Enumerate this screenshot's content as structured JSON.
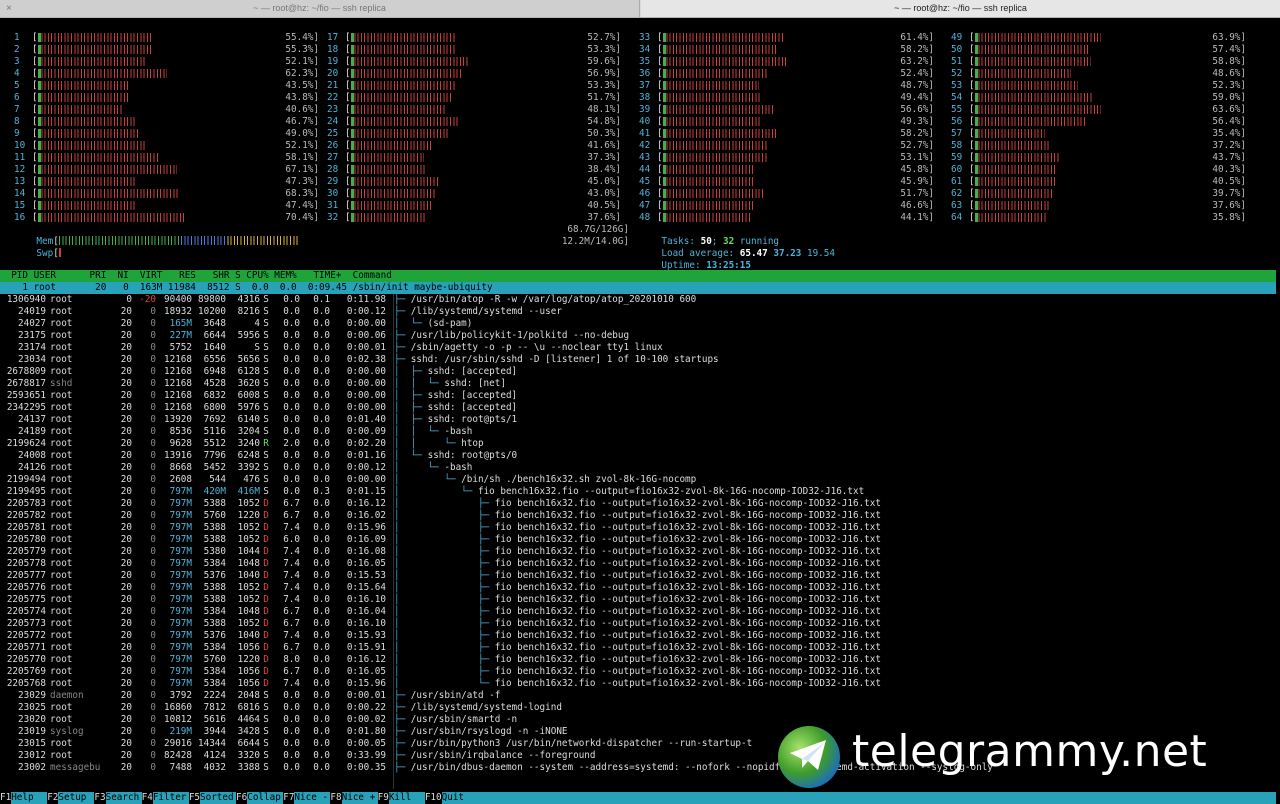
{
  "tabs": [
    "~ — root@hz: ~/fio — ssh replica",
    "~ — root@hz: ~/fio — ssh replica"
  ],
  "close_glyph": "×",
  "cpus": [
    {
      "id": "1",
      "pct": "55.4%]",
      "v": 55.4
    },
    {
      "id": "2",
      "pct": "55.3%]",
      "v": 55.3
    },
    {
      "id": "3",
      "pct": "52.1%]",
      "v": 52.1
    },
    {
      "id": "4",
      "pct": "62.3%]",
      "v": 62.3
    },
    {
      "id": "5",
      "pct": "43.5%]",
      "v": 43.5
    },
    {
      "id": "6",
      "pct": "43.8%]",
      "v": 43.8
    },
    {
      "id": "7",
      "pct": "40.6%]",
      "v": 40.6
    },
    {
      "id": "8",
      "pct": "46.7%]",
      "v": 46.7
    },
    {
      "id": "9",
      "pct": "49.0%]",
      "v": 49.0
    },
    {
      "id": "10",
      "pct": "52.1%]",
      "v": 52.1
    },
    {
      "id": "11",
      "pct": "58.1%]",
      "v": 58.1
    },
    {
      "id": "12",
      "pct": "67.1%]",
      "v": 67.1
    },
    {
      "id": "13",
      "pct": "47.3%]",
      "v": 47.3
    },
    {
      "id": "14",
      "pct": "68.3%]",
      "v": 68.3
    },
    {
      "id": "15",
      "pct": "47.4%]",
      "v": 47.4
    },
    {
      "id": "16",
      "pct": "70.4%]",
      "v": 70.4
    },
    {
      "id": "17",
      "pct": "52.7%]",
      "v": 52.7
    },
    {
      "id": "18",
      "pct": "53.3%]",
      "v": 53.3
    },
    {
      "id": "19",
      "pct": "59.6%]",
      "v": 59.6
    },
    {
      "id": "20",
      "pct": "56.9%]",
      "v": 56.9
    },
    {
      "id": "21",
      "pct": "53.3%]",
      "v": 53.3
    },
    {
      "id": "22",
      "pct": "51.7%]",
      "v": 51.7
    },
    {
      "id": "23",
      "pct": "48.1%]",
      "v": 48.1
    },
    {
      "id": "24",
      "pct": "54.8%]",
      "v": 54.8
    },
    {
      "id": "25",
      "pct": "50.3%]",
      "v": 50.3
    },
    {
      "id": "26",
      "pct": "41.6%]",
      "v": 41.6
    },
    {
      "id": "27",
      "pct": "37.3%]",
      "v": 37.3
    },
    {
      "id": "28",
      "pct": "38.4%]",
      "v": 38.4
    },
    {
      "id": "29",
      "pct": "45.0%]",
      "v": 45.0
    },
    {
      "id": "30",
      "pct": "43.0%]",
      "v": 43.0
    },
    {
      "id": "31",
      "pct": "40.5%]",
      "v": 40.5
    },
    {
      "id": "32",
      "pct": "37.6%]",
      "v": 37.6
    },
    {
      "id": "33",
      "pct": "61.4%]",
      "v": 61.4
    },
    {
      "id": "34",
      "pct": "58.2%]",
      "v": 58.2
    },
    {
      "id": "35",
      "pct": "63.2%]",
      "v": 63.2
    },
    {
      "id": "36",
      "pct": "52.4%]",
      "v": 52.4
    },
    {
      "id": "37",
      "pct": "48.7%]",
      "v": 48.7
    },
    {
      "id": "38",
      "pct": "49.4%]",
      "v": 49.4
    },
    {
      "id": "39",
      "pct": "56.6%]",
      "v": 56.6
    },
    {
      "id": "40",
      "pct": "49.3%]",
      "v": 49.3
    },
    {
      "id": "41",
      "pct": "58.2%]",
      "v": 58.2
    },
    {
      "id": "42",
      "pct": "52.7%]",
      "v": 52.7
    },
    {
      "id": "43",
      "pct": "53.1%]",
      "v": 53.1
    },
    {
      "id": "44",
      "pct": "45.8%]",
      "v": 45.8
    },
    {
      "id": "45",
      "pct": "45.9%]",
      "v": 45.9
    },
    {
      "id": "46",
      "pct": "51.7%]",
      "v": 51.7
    },
    {
      "id": "47",
      "pct": "46.6%]",
      "v": 46.6
    },
    {
      "id": "48",
      "pct": "44.1%]",
      "v": 44.1
    },
    {
      "id": "49",
      "pct": "63.9%]",
      "v": 63.9
    },
    {
      "id": "50",
      "pct": "57.4%]",
      "v": 57.4
    },
    {
      "id": "51",
      "pct": "58.8%]",
      "v": 58.8
    },
    {
      "id": "52",
      "pct": "48.6%]",
      "v": 48.6
    },
    {
      "id": "53",
      "pct": "52.3%]",
      "v": 52.3
    },
    {
      "id": "54",
      "pct": "59.0%]",
      "v": 59.0
    },
    {
      "id": "55",
      "pct": "63.6%]",
      "v": 63.6
    },
    {
      "id": "56",
      "pct": "56.4%]",
      "v": 56.4
    },
    {
      "id": "57",
      "pct": "35.4%]",
      "v": 35.4
    },
    {
      "id": "58",
      "pct": "37.2%]",
      "v": 37.2
    },
    {
      "id": "59",
      "pct": "43.7%]",
      "v": 43.7
    },
    {
      "id": "60",
      "pct": "40.3%]",
      "v": 40.3
    },
    {
      "id": "61",
      "pct": "40.5%]",
      "v": 40.5
    },
    {
      "id": "62",
      "pct": "39.7%]",
      "v": 39.7
    },
    {
      "id": "63",
      "pct": "37.6%]",
      "v": 37.6
    },
    {
      "id": "64",
      "pct": "35.8%]",
      "v": 35.8
    }
  ],
  "mem": {
    "label": "Mem",
    "value": "68.7G/126G]",
    "fill": 0.55
  },
  "swp": {
    "label": "Swp",
    "value": "12.2M/14.0G]",
    "fill": 0.001
  },
  "tasks": {
    "label": "Tasks:",
    "count": "50",
    "sep": ";",
    "running": "32",
    "running_label": "running"
  },
  "load": {
    "label": "Load average:",
    "l1": "65.47",
    "l5": "37.23",
    "l15": "19.54"
  },
  "uptime": {
    "label": "Uptime:",
    "value": "13:25:15"
  },
  "header": "  PID USER      PRI  NI  VIRT   RES   SHR S CPU% MEM%   TIME+  Command",
  "selected": "    1 root       20   0  163M 11984  8512 S  0.0  0.0  0:09.45 /sbin/init maybe-ubiquity",
  "rows": [
    {
      "pid": "1306940",
      "user": "root",
      "pri": "0",
      "ni": "-20",
      "virt": "90400",
      "res": "89800",
      "shr": "4316",
      "s": "S",
      "cpu": "0.0",
      "mem": "0.1",
      "time": "0:11.98",
      "tree": "├─ ",
      "cmd": "/usr/bin/atop -R -w /var/log/atop/atop_20201010 600"
    },
    {
      "pid": "24019",
      "user": "root",
      "pri": "20",
      "ni": "0",
      "virt": "18932",
      "res": "10200",
      "shr": "8216",
      "s": "S",
      "cpu": "0.0",
      "mem": "0.0",
      "time": "0:00.12",
      "tree": "├─ ",
      "cmd": "/lib/systemd/systemd --user"
    },
    {
      "pid": "24027",
      "user": "root",
      "pri": "20",
      "ni": "0",
      "virt": "165M",
      "res": "3648",
      "shr": "4",
      "s": "S",
      "cpu": "0.0",
      "mem": "0.0",
      "time": "0:00.00",
      "tree": "│  └─ ",
      "cmd": "(sd-pam)"
    },
    {
      "pid": "23175",
      "user": "root",
      "pri": "20",
      "ni": "0",
      "virt": "227M",
      "res": "6644",
      "shr": "5956",
      "s": "S",
      "cpu": "0.0",
      "mem": "0.0",
      "time": "0:00.06",
      "tree": "├─ ",
      "cmd": "/usr/lib/policykit-1/polkitd --no-debug"
    },
    {
      "pid": "23174",
      "user": "root",
      "pri": "20",
      "ni": "0",
      "virt": "5752",
      "res": "1640",
      "shr": "S",
      "s": "S",
      "cpu": "0.0",
      "mem": "0.0",
      "time": "0:00.01",
      "tree": "├─ ",
      "cmd": "/sbin/agetty -o -p -- \\u --noclear tty1 linux"
    },
    {
      "pid": "23034",
      "user": "root",
      "pri": "20",
      "ni": "0",
      "virt": "12168",
      "res": "6556",
      "shr": "5656",
      "s": "S",
      "cpu": "0.0",
      "mem": "0.0",
      "time": "0:02.38",
      "tree": "├─ ",
      "cmd": "sshd: /usr/sbin/sshd -D [listener] 1 of 10-100 startups"
    },
    {
      "pid": "2678809",
      "user": "root",
      "pri": "20",
      "ni": "0",
      "virt": "12168",
      "res": "6948",
      "shr": "6128",
      "s": "S",
      "cpu": "0.0",
      "mem": "0.0",
      "time": "0:00.00",
      "tree": "│  ├─ ",
      "cmd": "sshd: [accepted]"
    },
    {
      "pid": "2678817",
      "user": "sshd",
      "pri": "20",
      "ni": "0",
      "virt": "12168",
      "res": "4528",
      "shr": "3620",
      "s": "S",
      "cpu": "0.0",
      "mem": "0.0",
      "time": "0:00.00",
      "tree": "│  │  └─ ",
      "cmd": "sshd: [net]"
    },
    {
      "pid": "2593651",
      "user": "root",
      "pri": "20",
      "ni": "0",
      "virt": "12168",
      "res": "6832",
      "shr": "6008",
      "s": "S",
      "cpu": "0.0",
      "mem": "0.0",
      "time": "0:00.00",
      "tree": "│  ├─ ",
      "cmd": "sshd: [accepted]"
    },
    {
      "pid": "2342295",
      "user": "root",
      "pri": "20",
      "ni": "0",
      "virt": "12168",
      "res": "6800",
      "shr": "5976",
      "s": "S",
      "cpu": "0.0",
      "mem": "0.0",
      "time": "0:00.00",
      "tree": "│  ├─ ",
      "cmd": "sshd: [accepted]"
    },
    {
      "pid": "24137",
      "user": "root",
      "pri": "20",
      "ni": "0",
      "virt": "13920",
      "res": "7692",
      "shr": "6140",
      "s": "S",
      "cpu": "0.0",
      "mem": "0.0",
      "time": "0:01.40",
      "tree": "│  ├─ ",
      "cmd": "sshd: root@pts/1"
    },
    {
      "pid": "24189",
      "user": "root",
      "pri": "20",
      "ni": "0",
      "virt": "8536",
      "res": "5116",
      "shr": "3204",
      "s": "S",
      "cpu": "0.0",
      "mem": "0.0",
      "time": "0:00.09",
      "tree": "│  │  └─ ",
      "cmd": "-bash"
    },
    {
      "pid": "2199624",
      "user": "root",
      "pri": "20",
      "ni": "0",
      "virt": "9628",
      "res": "5512",
      "shr": "3240",
      "s": "R",
      "cpu": "2.0",
      "mem": "0.0",
      "time": "0:02.20",
      "tree": "│  │     └─ ",
      "cmd": "htop"
    },
    {
      "pid": "24008",
      "user": "root",
      "pri": "20",
      "ni": "0",
      "virt": "13916",
      "res": "7796",
      "shr": "6248",
      "s": "S",
      "cpu": "0.0",
      "mem": "0.0",
      "time": "0:01.16",
      "tree": "│  └─ ",
      "cmd": "sshd: root@pts/0"
    },
    {
      "pid": "24126",
      "user": "root",
      "pri": "20",
      "ni": "0",
      "virt": "8668",
      "res": "5452",
      "shr": "3392",
      "s": "S",
      "cpu": "0.0",
      "mem": "0.0",
      "time": "0:00.12",
      "tree": "│     └─ ",
      "cmd": "-bash"
    },
    {
      "pid": "2199494",
      "user": "root",
      "pri": "20",
      "ni": "0",
      "virt": "2608",
      "res": "544",
      "shr": "476",
      "s": "S",
      "cpu": "0.0",
      "mem": "0.0",
      "time": "0:00.00",
      "tree": "│        └─ ",
      "cmd": "/bin/sh ./bench16x32.sh zvol-8k-16G-nocomp"
    },
    {
      "pid": "2199495",
      "user": "root",
      "pri": "20",
      "ni": "0",
      "virt": "797M",
      "res": "420M",
      "shr": "416M",
      "s": "S",
      "cpu": "0.0",
      "mem": "0.3",
      "time": "0:01.15",
      "tree": "│           └─ ",
      "cmd": "fio bench16x32.fio --output=fio16x32-zvol-8k-16G-nocomp-IOD32-J16.txt"
    },
    {
      "pid": "2205783",
      "user": "root",
      "pri": "20",
      "ni": "0",
      "virt": "797M",
      "res": "5388",
      "shr": "1052",
      "s": "D",
      "cpu": "6.7",
      "mem": "0.0",
      "time": "0:16.12",
      "tree": "│              ├─ ",
      "cmd": "fio bench16x32.fio --output=fio16x32-zvol-8k-16G-nocomp-IOD32-J16.txt"
    },
    {
      "pid": "2205782",
      "user": "root",
      "pri": "20",
      "ni": "0",
      "virt": "797M",
      "res": "5760",
      "shr": "1220",
      "s": "D",
      "cpu": "6.7",
      "mem": "0.0",
      "time": "0:16.02",
      "tree": "│              ├─ ",
      "cmd": "fio bench16x32.fio --output=fio16x32-zvol-8k-16G-nocomp-IOD32-J16.txt"
    },
    {
      "pid": "2205781",
      "user": "root",
      "pri": "20",
      "ni": "0",
      "virt": "797M",
      "res": "5388",
      "shr": "1052",
      "s": "D",
      "cpu": "7.4",
      "mem": "0.0",
      "time": "0:15.96",
      "tree": "│              ├─ ",
      "cmd": "fio bench16x32.fio --output=fio16x32-zvol-8k-16G-nocomp-IOD32-J16.txt"
    },
    {
      "pid": "2205780",
      "user": "root",
      "pri": "20",
      "ni": "0",
      "virt": "797M",
      "res": "5388",
      "shr": "1052",
      "s": "D",
      "cpu": "6.0",
      "mem": "0.0",
      "time": "0:16.09",
      "tree": "│              ├─ ",
      "cmd": "fio bench16x32.fio --output=fio16x32-zvol-8k-16G-nocomp-IOD32-J16.txt"
    },
    {
      "pid": "2205779",
      "user": "root",
      "pri": "20",
      "ni": "0",
      "virt": "797M",
      "res": "5380",
      "shr": "1044",
      "s": "D",
      "cpu": "7.4",
      "mem": "0.0",
      "time": "0:16.08",
      "tree": "│              ├─ ",
      "cmd": "fio bench16x32.fio --output=fio16x32-zvol-8k-16G-nocomp-IOD32-J16.txt"
    },
    {
      "pid": "2205778",
      "user": "root",
      "pri": "20",
      "ni": "0",
      "virt": "797M",
      "res": "5384",
      "shr": "1048",
      "s": "D",
      "cpu": "7.4",
      "mem": "0.0",
      "time": "0:16.05",
      "tree": "│              ├─ ",
      "cmd": "fio bench16x32.fio --output=fio16x32-zvol-8k-16G-nocomp-IOD32-J16.txt"
    },
    {
      "pid": "2205777",
      "user": "root",
      "pri": "20",
      "ni": "0",
      "virt": "797M",
      "res": "5376",
      "shr": "1040",
      "s": "D",
      "cpu": "7.4",
      "mem": "0.0",
      "time": "0:15.53",
      "tree": "│              ├─ ",
      "cmd": "fio bench16x32.fio --output=fio16x32-zvol-8k-16G-nocomp-IOD32-J16.txt"
    },
    {
      "pid": "2205776",
      "user": "root",
      "pri": "20",
      "ni": "0",
      "virt": "797M",
      "res": "5388",
      "shr": "1052",
      "s": "D",
      "cpu": "7.4",
      "mem": "0.0",
      "time": "0:15.64",
      "tree": "│              ├─ ",
      "cmd": "fio bench16x32.fio --output=fio16x32-zvol-8k-16G-nocomp-IOD32-J16.txt"
    },
    {
      "pid": "2205775",
      "user": "root",
      "pri": "20",
      "ni": "0",
      "virt": "797M",
      "res": "5388",
      "shr": "1052",
      "s": "D",
      "cpu": "7.4",
      "mem": "0.0",
      "time": "0:16.10",
      "tree": "│              ├─ ",
      "cmd": "fio bench16x32.fio --output=fio16x32-zvol-8k-16G-nocomp-IOD32-J16.txt"
    },
    {
      "pid": "2205774",
      "user": "root",
      "pri": "20",
      "ni": "0",
      "virt": "797M",
      "res": "5384",
      "shr": "1048",
      "s": "D",
      "cpu": "6.7",
      "mem": "0.0",
      "time": "0:16.04",
      "tree": "│              ├─ ",
      "cmd": "fio bench16x32.fio --output=fio16x32-zvol-8k-16G-nocomp-IOD32-J16.txt"
    },
    {
      "pid": "2205773",
      "user": "root",
      "pri": "20",
      "ni": "0",
      "virt": "797M",
      "res": "5388",
      "shr": "1052",
      "s": "D",
      "cpu": "6.7",
      "mem": "0.0",
      "time": "0:16.10",
      "tree": "│              ├─ ",
      "cmd": "fio bench16x32.fio --output=fio16x32-zvol-8k-16G-nocomp-IOD32-J16.txt"
    },
    {
      "pid": "2205772",
      "user": "root",
      "pri": "20",
      "ni": "0",
      "virt": "797M",
      "res": "5376",
      "shr": "1040",
      "s": "D",
      "cpu": "7.4",
      "mem": "0.0",
      "time": "0:15.93",
      "tree": "│              ├─ ",
      "cmd": "fio bench16x32.fio --output=fio16x32-zvol-8k-16G-nocomp-IOD32-J16.txt"
    },
    {
      "pid": "2205771",
      "user": "root",
      "pri": "20",
      "ni": "0",
      "virt": "797M",
      "res": "5384",
      "shr": "1056",
      "s": "D",
      "cpu": "6.7",
      "mem": "0.0",
      "time": "0:15.91",
      "tree": "│              ├─ ",
      "cmd": "fio bench16x32.fio --output=fio16x32-zvol-8k-16G-nocomp-IOD32-J16.txt"
    },
    {
      "pid": "2205770",
      "user": "root",
      "pri": "20",
      "ni": "0",
      "virt": "797M",
      "res": "5760",
      "shr": "1220",
      "s": "D",
      "cpu": "8.0",
      "mem": "0.0",
      "time": "0:16.12",
      "tree": "│              ├─ ",
      "cmd": "fio bench16x32.fio --output=fio16x32-zvol-8k-16G-nocomp-IOD32-J16.txt"
    },
    {
      "pid": "2205769",
      "user": "root",
      "pri": "20",
      "ni": "0",
      "virt": "797M",
      "res": "5384",
      "shr": "1056",
      "s": "D",
      "cpu": "6.7",
      "mem": "0.0",
      "time": "0:16.05",
      "tree": "│              ├─ ",
      "cmd": "fio bench16x32.fio --output=fio16x32-zvol-8k-16G-nocomp-IOD32-J16.txt"
    },
    {
      "pid": "2205768",
      "user": "root",
      "pri": "20",
      "ni": "0",
      "virt": "797M",
      "res": "5384",
      "shr": "1056",
      "s": "D",
      "cpu": "7.4",
      "mem": "0.0",
      "time": "0:15.96",
      "tree": "│              └─ ",
      "cmd": "fio bench16x32.fio --output=fio16x32-zvol-8k-16G-nocomp-IOD32-J16.txt"
    },
    {
      "pid": "23029",
      "user": "daemon",
      "pri": "20",
      "ni": "0",
      "virt": "3792",
      "res": "2224",
      "shr": "2048",
      "s": "S",
      "cpu": "0.0",
      "mem": "0.0",
      "time": "0:00.01",
      "tree": "├─ ",
      "cmd": "/usr/sbin/atd -f"
    },
    {
      "pid": "23025",
      "user": "root",
      "pri": "20",
      "ni": "0",
      "virt": "16860",
      "res": "7812",
      "shr": "6816",
      "s": "S",
      "cpu": "0.0",
      "mem": "0.0",
      "time": "0:00.22",
      "tree": "├─ ",
      "cmd": "/lib/systemd/systemd-logind"
    },
    {
      "pid": "23020",
      "user": "root",
      "pri": "20",
      "ni": "0",
      "virt": "10812",
      "res": "5616",
      "shr": "4464",
      "s": "S",
      "cpu": "0.0",
      "mem": "0.0",
      "time": "0:00.02",
      "tree": "├─ ",
      "cmd": "/usr/sbin/smartd -n"
    },
    {
      "pid": "23019",
      "user": "syslog",
      "pri": "20",
      "ni": "0",
      "virt": "219M",
      "res": "3944",
      "shr": "3428",
      "s": "S",
      "cpu": "0.0",
      "mem": "0.0",
      "time": "0:01.80",
      "tree": "├─ ",
      "cmd": "/usr/sbin/rsyslogd -n -iNONE"
    },
    {
      "pid": "23015",
      "user": "root",
      "pri": "20",
      "ni": "0",
      "virt": "29016",
      "res": "14344",
      "shr": "6644",
      "s": "S",
      "cpu": "0.0",
      "mem": "0.0",
      "time": "0:00.05",
      "tree": "├─ ",
      "cmd": "/usr/bin/python3 /usr/bin/networkd-dispatcher --run-startup-t"
    },
    {
      "pid": "23012",
      "user": "root",
      "pri": "20",
      "ni": "0",
      "virt": "82428",
      "res": "4124",
      "shr": "3320",
      "s": "S",
      "cpu": "0.0",
      "mem": "0.0",
      "time": "0:33.99",
      "tree": "├─ ",
      "cmd": "/usr/sbin/irqbalance --foreground"
    },
    {
      "pid": "23002",
      "user": "messagebu",
      "pri": "20",
      "ni": "0",
      "virt": "7488",
      "res": "4032",
      "shr": "3388",
      "s": "S",
      "cpu": "0.0",
      "mem": "0.0",
      "time": "0:00.35",
      "tree": "├─ ",
      "cmd": "/usr/bin/dbus-daemon --system --address=systemd: --nofork --nopidfile --systemd-activation --syslog-only"
    }
  ],
  "fkeys": [
    {
      "k": "F1",
      "v": "Help"
    },
    {
      "k": "F2",
      "v": "Setup"
    },
    {
      "k": "F3",
      "v": "Search"
    },
    {
      "k": "F4",
      "v": "Filter"
    },
    {
      "k": "F5",
      "v": "Sorted"
    },
    {
      "k": "F6",
      "v": "Collap"
    },
    {
      "k": "F7",
      "v": "Nice -"
    },
    {
      "k": "F8",
      "v": "Nice +"
    },
    {
      "k": "F9",
      "v": "Kill"
    },
    {
      "k": "F10",
      "v": "Quit"
    }
  ],
  "watermark": "telegrammy.net",
  "colors": {
    "green_bar": "#3fb24a",
    "red_bar": "#c5403d",
    "cyan": "#4fb3d9",
    "header_green": "#1fa43a",
    "select_cyan": "#27a2b8"
  }
}
